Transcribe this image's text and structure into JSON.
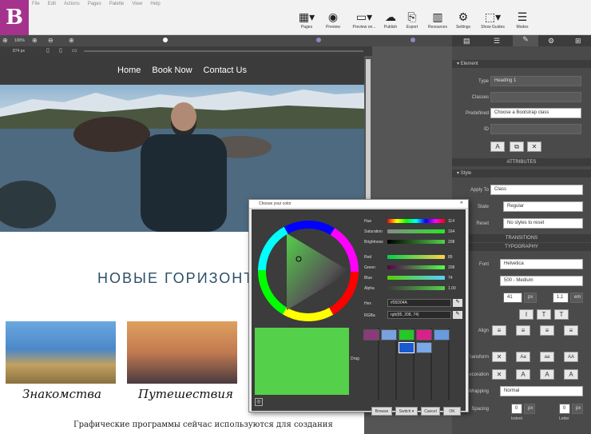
{
  "app": {
    "logo_letter": "B",
    "brand_color": "#a5338e"
  },
  "menu": [
    "File",
    "Edit",
    "Actions",
    "Pages",
    "Palette",
    "View",
    "Help"
  ],
  "toolbar": [
    {
      "label": "Pages",
      "icon": "pages-icon"
    },
    {
      "label": "Preview",
      "icon": "eye-icon"
    },
    {
      "label": "Preview on...",
      "icon": "monitor-icon"
    },
    {
      "label": "Publish",
      "icon": "cloud-upload-icon"
    },
    {
      "label": "Export",
      "icon": "export-icon"
    },
    {
      "label": "Resources",
      "icon": "resources-icon"
    },
    {
      "label": "Settings",
      "icon": "gear-icon"
    },
    {
      "label": "Show Guides",
      "icon": "guides-icon"
    },
    {
      "label": "Modes",
      "icon": "modes-icon"
    }
  ],
  "zoom": {
    "value": "100%"
  },
  "canvas_width": "874 px",
  "site": {
    "nav": [
      "Home",
      "Book Now",
      "Contact Us"
    ],
    "heading": "НОВЫЕ ГОРИЗОНТ",
    "cards": [
      "Знакомства",
      "Путешествия"
    ],
    "paragraph": "Графические программы сейчас используются для создания"
  },
  "panel": {
    "section_element": "Element",
    "type_label": "Type",
    "type_value": "Heading 1",
    "classes_label": "Classes",
    "predefined_label": "Predefined",
    "predefined_value": "Choose a Bootstrap class",
    "id_label": "ID",
    "attributes": "ATTRIBUTES",
    "style_section": "Style",
    "apply_to_label": "Apply To",
    "apply_to_value": "Class",
    "state_label": "State",
    "state_value": "Regular",
    "reset_label": "Reset",
    "reset_value": "No styles to reset",
    "transitions": "TRANSITIONS",
    "typography": "TYPOGRAPHY",
    "font_label": "Font",
    "font_value": "Helvetica",
    "weight_value": "500 - Medium",
    "size_value": "41",
    "size_unit": "px",
    "line_value": "1,1",
    "line_unit": "em",
    "align_label": "Align",
    "transform_label": "Transform",
    "transform_opts": [
      "Aa",
      "aa",
      "AA"
    ],
    "decoration_label": "Decoration",
    "wrapping_label": "Wrapping",
    "wrapping_value": "Normal",
    "spacing_label": "Spacing",
    "spacing_val1": "0",
    "spacing_unit": "px",
    "spacing_val2": "0",
    "indent_label": "Indent",
    "letter_label": "Letter"
  },
  "color_dialog": {
    "title": "Choose your color",
    "hue_label": "Hue",
    "hue": "114",
    "sat_label": "Saturation",
    "sat": "164",
    "bright_label": "Brightness",
    "bright": "208",
    "red_label": "Red",
    "red": "85",
    "green_label": "Green",
    "green": "208",
    "blue_label": "Blue",
    "blue": "74",
    "alpha_label": "Alpha",
    "alpha": "1.00",
    "hex_label": "Hex",
    "hex": "#55D04A",
    "rgba_label": "RGBa",
    "rgba": "rgb(85, 208, 74)",
    "drag_label": "Drag",
    "browse": "Browse",
    "switch": "Switch ▾",
    "cancel": "Cancel",
    "ok": "OK",
    "current_color": "#55d04a",
    "swatches": [
      "#8a3a7a",
      "#7aa0e0",
      "#26c826",
      "#d8228a",
      "#6a9ae0",
      "#1a5ad0",
      "#7aa8e8"
    ]
  }
}
